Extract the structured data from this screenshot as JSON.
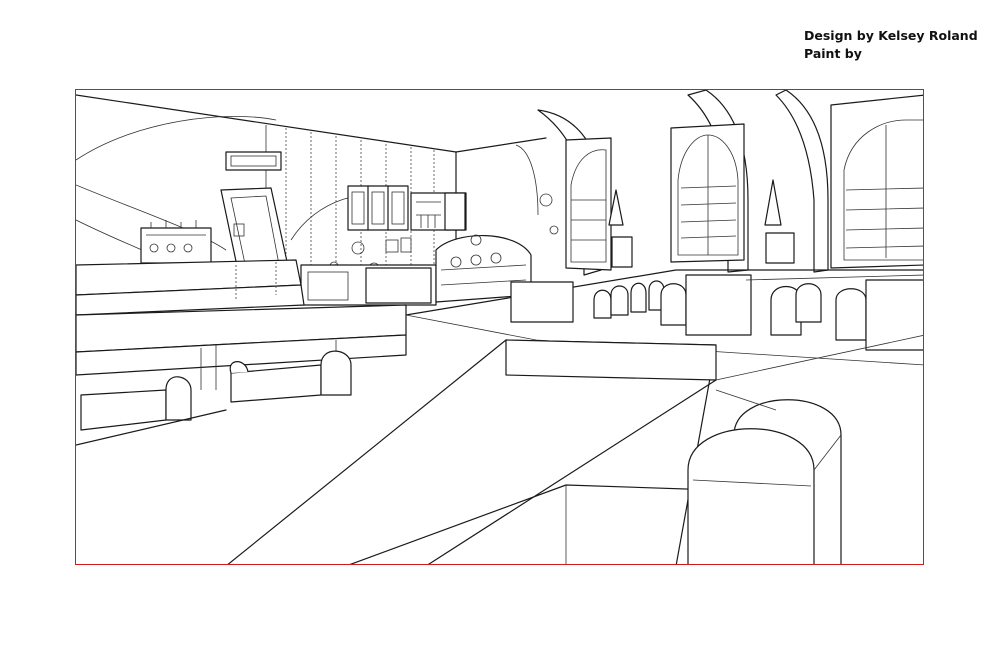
{
  "credits": {
    "design": "Design by Kelsey Roland",
    "paint": "Paint by"
  },
  "colors": {
    "frame_border": "#d11a1a",
    "line_art": "#1a1a1a",
    "background": "#ffffff"
  }
}
